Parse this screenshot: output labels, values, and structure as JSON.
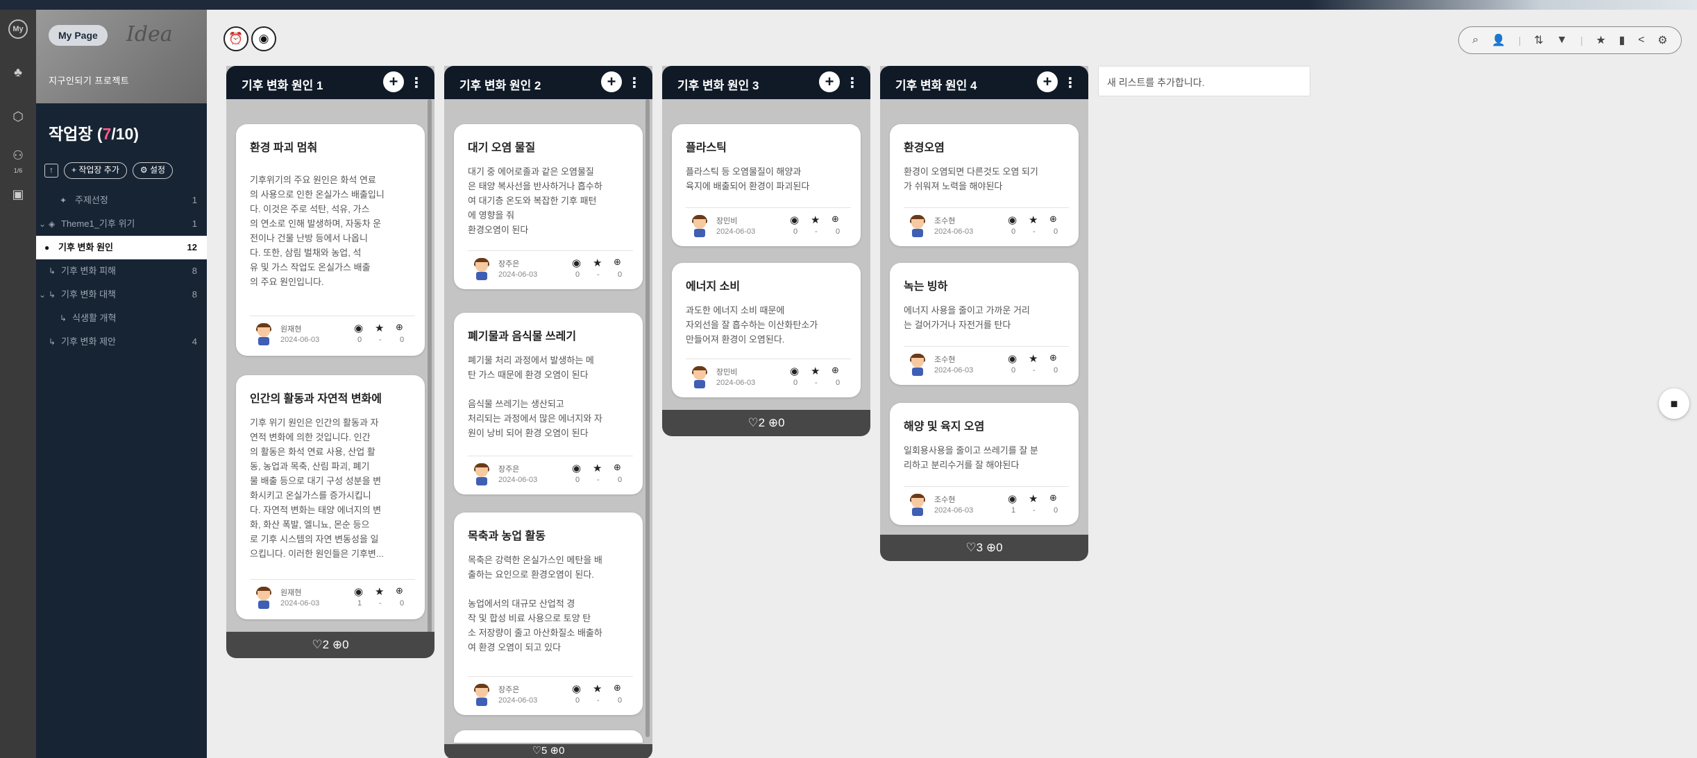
{
  "sidebar": {
    "my_label": "My",
    "my_page": "My Page",
    "scribble": "Idea",
    "project_name": "지구인되기 프로젝트",
    "workspace_title_prefix": "작업장 (",
    "workspace_current": "7",
    "workspace_total": "/10)",
    "member_count": "1/6",
    "add_workspace": "+ 작업장 추가",
    "settings": "⚙ 설정",
    "items": [
      {
        "label": "주제선정",
        "count": "1"
      },
      {
        "label": "Theme1_기후 위기",
        "count": "1"
      },
      {
        "label": "기후 변화 원인",
        "count": "12"
      },
      {
        "label": "기후 변화 피해",
        "count": "8"
      },
      {
        "label": "기후 변화 대책",
        "count": "8"
      },
      {
        "label": "식생활 개혁",
        "count": ""
      },
      {
        "label": "기후 변화 제안",
        "count": "4"
      }
    ]
  },
  "new_list_label": "새 리스트를 추가합니다.",
  "columns": [
    {
      "title": "기후 변화 원인 1",
      "footer": "♡2 ⊕0",
      "cards": [
        {
          "title": "환경 파괴 멈춰",
          "body": "기후위기의 주요 원인은 화석 연료\n의 사용으로 인한 온실가스 배출입니\n다. 이것은 주로 석탄, 석유, 가스\n의 연소로 인해 발생하며, 자동차 운\n전이나 건물 난방 등에서 나옵니\n다. 또한, 삼림 벌채와 농업, 석\n유 및 가스 작업도 온실가스 배출\n의 주요 원인입니다.",
          "author": "원재현",
          "date": "2024-06-03",
          "views": "0",
          "stars": "-",
          "comments": "0"
        },
        {
          "title": "인간의 활동과 자연적 변화에",
          "body": "기후 위기 원인은 인간의 활동과 자\n연적 변화에 의한 것입니다. 인간\n의 활동은 화석 연료 사용, 산업 활\n동, 농업과 목축, 산림 파괴, 폐기\n물 배출 등으로 대기 구성 성분을 변\n화시키고 온실가스를 증가시킵니\n다. 자연적 변화는 태양 에너지의 변\n화, 화산 폭발, 엘니뇨, 몬순 등으\n로 기후 시스템의 자연 변동성을 일\n으킵니다. 이러한 원인들은 기후변...",
          "author": "원재현",
          "date": "2024-06-03",
          "views": "1",
          "stars": "-",
          "comments": "0"
        }
      ]
    },
    {
      "title": "기후 변화 원인 2",
      "footer": "♡5 ⊕0",
      "cards": [
        {
          "title": "대기 오염 물질",
          "body": "대기 중 에어로졸과 같은 오염물질\n은 태양 복사선을 반사하거나 흡수하\n여 대기층 온도와 복잡한 기후 패턴\n에 영향을 줘\n환경오염이 된다",
          "author": "장주은",
          "date": "2024-06-03",
          "views": "0",
          "stars": "-",
          "comments": "0"
        },
        {
          "title": "폐기물과 음식물 쓰레기",
          "body": "폐기물 처리 과정에서 발생하는 메\n탄 가스 때문에 환경 오염이 된다\n\n음식물 쓰레기는 생산되고\n처리되는 과정에서 많은 에너지와 자\n원이 낭비 되어 환경 오염이 된다",
          "author": "장주은",
          "date": "2024-06-03",
          "views": "0",
          "stars": "-",
          "comments": "0"
        },
        {
          "title": "목축과 농업 활동",
          "body": "목축은 강력한 온실가스인 메탄을 배\n출하는 요인으로 환경오염이 된다.\n\n농업에서의 대규모 산업적 경\n작 및 합성 비료 사용으로 토양 탄\n소 저장량이 줄고 아산화질소 배출하\n여 환경 오염이 되고 있다",
          "author": "장주은",
          "date": "2024-06-03",
          "views": "0",
          "stars": "-",
          "comments": "0"
        }
      ]
    },
    {
      "title": "기후 변화 원인 3",
      "footer": "♡2 ⊕0",
      "cards": [
        {
          "title": "플라스틱",
          "body": "플라스틱 등 오염물질이 해양과\n육지에 배출되어 환경이 파괴된다",
          "author": "장민비",
          "date": "2024-06-03",
          "views": "0",
          "stars": "-",
          "comments": "0"
        },
        {
          "title": "에너지 소비",
          "body": "과도한 에너지 소비 때문에\n자외선을 잘 흡수하는 이산화탄소가\n만들어져 환경이 오염된다.",
          "author": "장민비",
          "date": "2024-06-03",
          "views": "0",
          "stars": "-",
          "comments": "0"
        }
      ]
    },
    {
      "title": "기후 변화 원인 4",
      "footer": "♡3 ⊕0",
      "cards": [
        {
          "title": "환경오염",
          "body": "환경이 오염되면 다른것도 오염 되기\n가 쉬워져 노력을 해야된다",
          "author": "조수현",
          "date": "2024-06-03",
          "views": "0",
          "stars": "-",
          "comments": "0"
        },
        {
          "title": "녹는 빙하",
          "body": "에너지 사용을 줄이고 가까운 거리\n는 걸어가거나 자전거를 탄다",
          "author": "조수현",
          "date": "2024-06-03",
          "views": "0",
          "stars": "-",
          "comments": "0"
        },
        {
          "title": "해양 및 육지 오염",
          "body": "일회용사용을 줄이고 쓰레기를 잘 분\n리하고 분리수거를 잘 해야된다",
          "author": "조수현",
          "date": "2024-06-03",
          "views": "1",
          "stars": "-",
          "comments": "0"
        }
      ]
    }
  ]
}
